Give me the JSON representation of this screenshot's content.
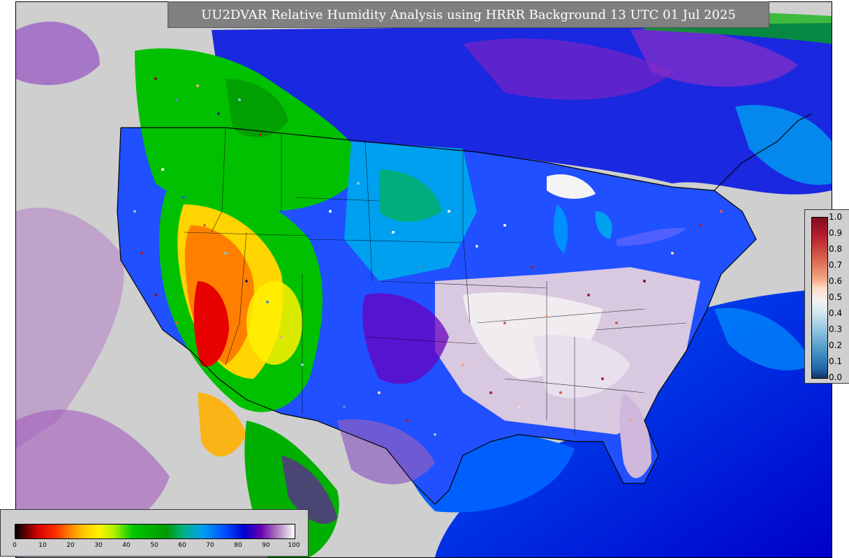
{
  "title": "UU2DVAR Relative Humidity Analysis using HRRR Background 13 UTC 01 Jul 2025",
  "map": {
    "background_color": "#cfcfcf",
    "land_outline_color": "#000000"
  },
  "obs_legend": {
    "ticks": [
      "1.0",
      "0.9",
      "0.8",
      "0.7",
      "0.6",
      "0.5",
      "0.4",
      "0.3",
      "0.2",
      "0.1",
      "0.0"
    ]
  },
  "rh_legend": {
    "ticks": [
      "0",
      "10",
      "20",
      "30",
      "40",
      "50",
      "60",
      "70",
      "80",
      "90",
      "100"
    ]
  }
}
